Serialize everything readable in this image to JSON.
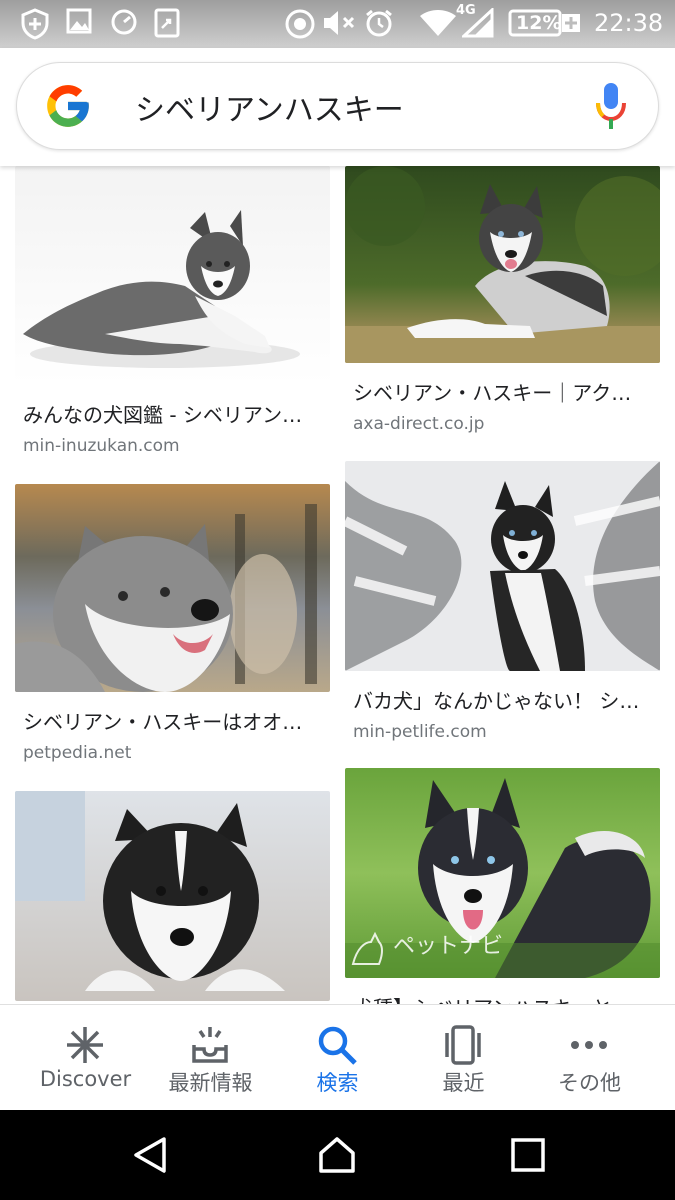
{
  "status_bar": {
    "network": "4G",
    "battery": "12%",
    "time": "22:38"
  },
  "search": {
    "query": "シベリアンハスキー"
  },
  "results": [
    {
      "title": "みんなの犬図鑑 - シベリアン…",
      "domain": "min-inuzukan.com"
    },
    {
      "title": "シベリアン・ハスキー｜アク…",
      "domain": "axa-direct.co.jp"
    },
    {
      "title": "シベリアン・ハスキーはオオ…",
      "domain": "petpedia.net"
    },
    {
      "title": "バカ犬」なんかじゃない！ シ…",
      "domain": "min-petlife.com"
    },
    {
      "title": "",
      "domain": ""
    },
    {
      "title": "犬種】シベリアンハスキーと…",
      "domain": ""
    }
  ],
  "watermark": "ペットナビ",
  "bottom_nav": [
    {
      "label": "Discover",
      "icon": "asterisk-icon"
    },
    {
      "label": "最新情報",
      "icon": "inbox-updates-icon"
    },
    {
      "label": "検索",
      "icon": "search-icon"
    },
    {
      "label": "最近",
      "icon": "recent-cards-icon"
    },
    {
      "label": "その他",
      "icon": "more-dots-icon"
    }
  ],
  "colors": {
    "accent": "#1a73e8",
    "text": "#202124",
    "muted": "#70757a"
  }
}
